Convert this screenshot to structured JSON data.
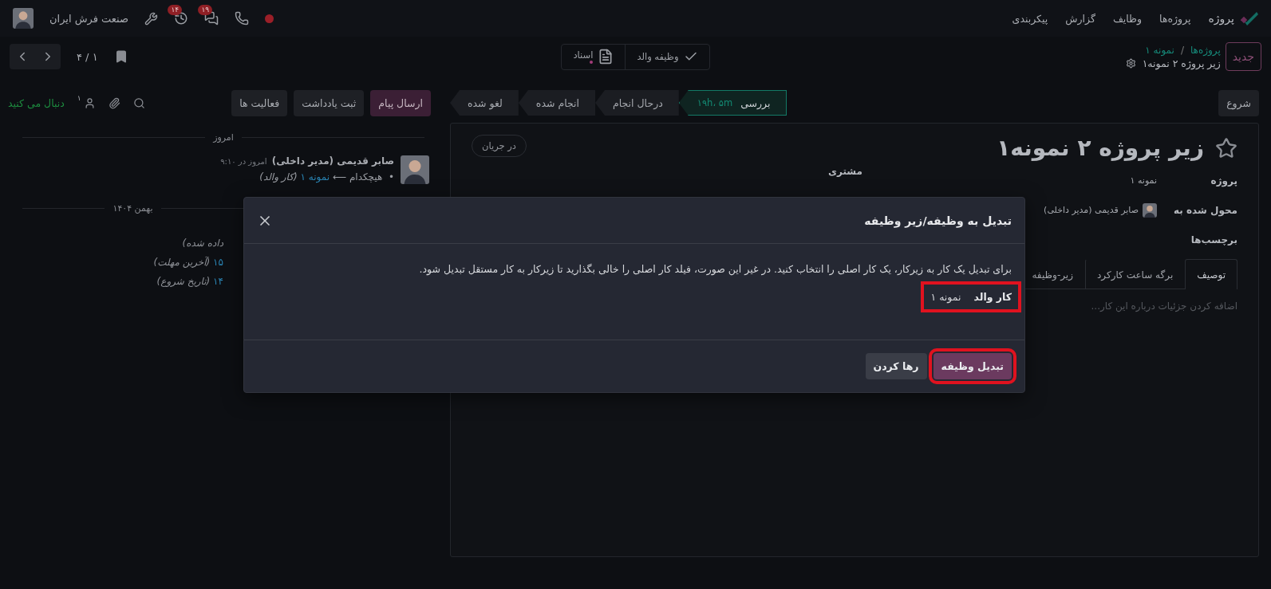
{
  "nav": {
    "app_name": "پروژه",
    "menu": [
      "پروژه‌ها",
      "وظایف",
      "گزارش",
      "پیکربندی"
    ],
    "company": "صنعت فرش ایران",
    "badges": [
      {
        "kind": "chat",
        "count": "۱۹"
      },
      {
        "kind": "activity",
        "count": "۱۴"
      }
    ]
  },
  "control": {
    "new_button": "جدید",
    "breadcrumbs": [
      "پروژه‌ها",
      "نمونه ۱"
    ],
    "breadcrumb_separator": "/",
    "record_title": "زیر پروژه ۲ نمونه۱",
    "smart_buttons": [
      {
        "kind": "check",
        "label": "وظیفه والد"
      },
      {
        "kind": "document",
        "label": "اسناد"
      }
    ],
    "pager": "۱ / ۴"
  },
  "status": {
    "start_button": "شروع",
    "stages": [
      {
        "label": "بررسی",
        "duration": "۱۹h، ۵m",
        "selected": true
      },
      {
        "label": "درحال انجام",
        "selected": false
      },
      {
        "label": "انجام شده",
        "selected": false
      },
      {
        "label": "لغو شده",
        "selected": false
      }
    ]
  },
  "form": {
    "title": "زیر پروژه ۲ نمونه۱",
    "state": "در جریان",
    "fields": [
      {
        "label": "پروژه",
        "value": "نمونه ۱"
      },
      {
        "label": "محول شده به",
        "value": "صابر قدیمی (مدیر داخلی)",
        "avatar": true
      },
      {
        "label": "برچسب‌ها"
      }
    ],
    "side_fields": [
      {
        "label": "مشتری"
      }
    ],
    "tabs": [
      {
        "label": "توصیف",
        "selected": true
      },
      {
        "label": "برگه ساعت کارکرد",
        "selected": false
      },
      {
        "label": "زیر-وظیفه",
        "selected": false
      }
    ],
    "placeholder": "اضافه کردن جزئیات درباره این کار..."
  },
  "chatter": {
    "buttons": [
      {
        "label": "ارسال پیام",
        "primary": true
      },
      {
        "label": "ثبت یادداشت",
        "primary": false
      },
      {
        "label": "فعالیت ها",
        "primary": false
      }
    ],
    "follower_count": "۱",
    "follow": "دنبال می کنید",
    "divider": "امروز",
    "message": {
      "author": "صابر قدیمی (مدیر داخلی)",
      "time": "امروز در ۹:۱۰",
      "bullet": "•",
      "arrow": "⟵",
      "old": "هیچکدام",
      "new": "نمونه ۱",
      "field": "(کار والد)"
    },
    "divider2": "بهمن ۱۴۰۴",
    "lines": [
      {
        "label": "داده شده)"
      },
      {
        "value": "۱۵",
        "label": "(آخرین مهلت)"
      },
      {
        "value": "۱۴",
        "label": "(تاریخ شروع)"
      }
    ]
  },
  "dialog": {
    "title": "تبدیل به وظیفه/زیر وظیفه",
    "text": "برای تبدیل یک کار به زیرکار، یک کار اصلی را انتخاب کنید. در غیر این صورت، فیلد کار اصلی را خالی بگذارید تا زیرکار به کار مستقل تبدیل شود.",
    "field": {
      "label": "کار والد",
      "value": "نمونه ۱",
      "highlighted": true
    },
    "buttons": [
      {
        "label": "تبدیل وظیفه",
        "primary": true,
        "highlighted": true
      },
      {
        "label": "رها کردن",
        "primary": false,
        "highlighted": false
      }
    ]
  }
}
